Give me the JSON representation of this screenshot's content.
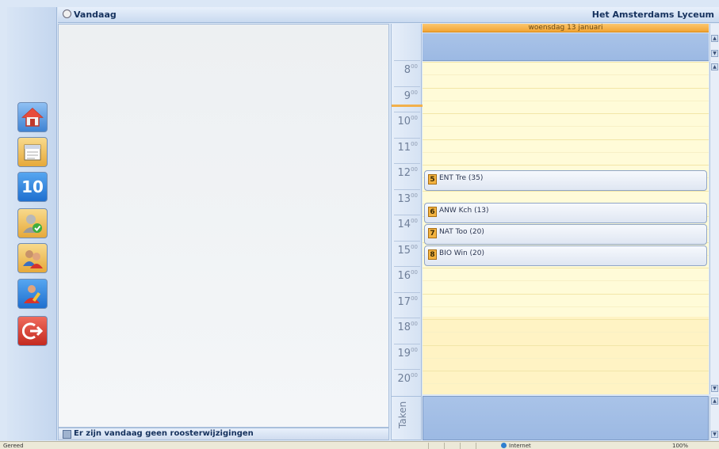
{
  "header": {
    "title": "Vandaag",
    "school": "Het Amsterdams Lyceum"
  },
  "toolbar": {
    "buttons": [
      {
        "name": "home",
        "icon": "house-icon"
      },
      {
        "name": "calendar",
        "icon": "calendar-icon"
      },
      {
        "name": "grades",
        "icon": "grade-10-icon",
        "label": "10"
      },
      {
        "name": "attendance",
        "icon": "person-check-icon"
      },
      {
        "name": "groups",
        "icon": "people-icon"
      },
      {
        "name": "assignments",
        "icon": "person-pencil-icon"
      },
      {
        "name": "logout",
        "icon": "logout-icon"
      }
    ]
  },
  "footer": {
    "text": "Er zijn vandaag geen roosterwijzigingen"
  },
  "calendar": {
    "day_label": "woensdag 13 januari",
    "hours": [
      "8",
      "9",
      "10",
      "11",
      "12",
      "13",
      "14",
      "15",
      "16",
      "17",
      "18",
      "19",
      "20"
    ],
    "hour_suffix": "00",
    "tasks_label": "Taken",
    "events": [
      {
        "period": "5",
        "text": "ENT Tre (35)"
      },
      {
        "period": "6",
        "text": "ANW Kch (13)"
      },
      {
        "period": "7",
        "text": "NAT Too (20)"
      },
      {
        "period": "8",
        "text": "BIO Win (20)"
      }
    ]
  },
  "statusbar": {
    "ready": "Gereed",
    "zone": "Internet",
    "zoom": "100%"
  },
  "colors": {
    "accent_orange": "#f3a432",
    "day_background": "#fffbd8",
    "header_blue": "#c9daf0"
  }
}
